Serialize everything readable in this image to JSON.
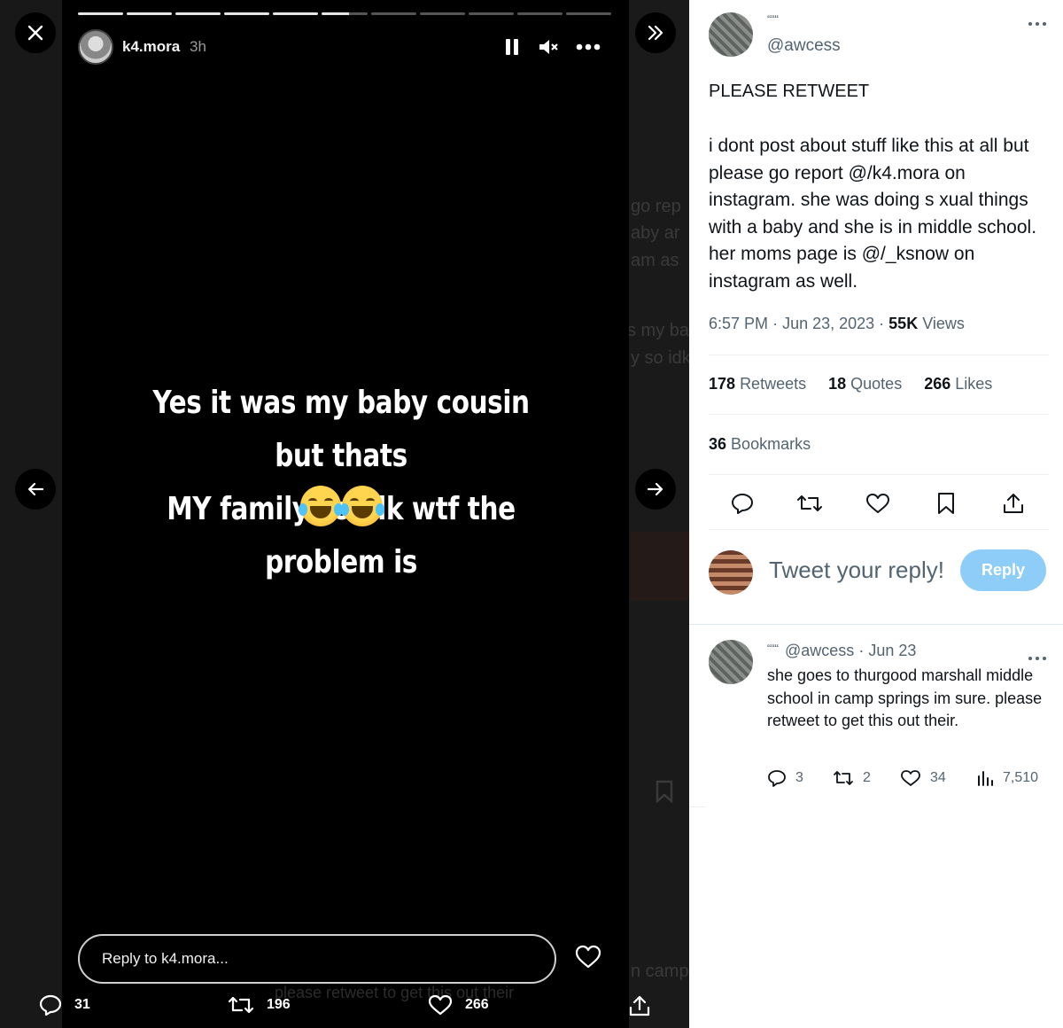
{
  "story": {
    "username": "k4.mora",
    "time": "3h",
    "text_line1": "Yes it was my baby cousin but thats",
    "text_line2": "MY family so idk wtf the problem is",
    "emojis": [
      "face-with-tears-of-joy",
      "face-with-tears-of-joy"
    ],
    "reply_placeholder": "Reply to k4.mora...",
    "progress_segments": 11,
    "progress_completed": 5.6
  },
  "background_peek": {
    "lines": [
      "go rep",
      "aby ar",
      "am as",
      "s my bab",
      "y so idk",
      "n camp",
      "please retweet to get this out their"
    ]
  },
  "viewer_bar": {
    "replies": "31",
    "retweets": "196",
    "likes": "266"
  },
  "tweet": {
    "display_name_glyph": "“““",
    "handle": "@awcess",
    "heading": "PLEASE RETWEET",
    "body": "i dont post about stuff like this at all but please go report @/k4.mora on instagram. she was doing s  xual things with a baby and she is in middle school. her moms page is @/_ksnow on instagram as well.",
    "time": "6:57 PM",
    "date": "Jun 23, 2023",
    "views_count": "55K",
    "views_label": "Views",
    "retweets_count": "178",
    "retweets_label": "Retweets",
    "quotes_count": "18",
    "quotes_label": "Quotes",
    "likes_count": "266",
    "likes_label": "Likes",
    "bookmarks_count": "36",
    "bookmarks_label": "Bookmarks"
  },
  "compose": {
    "placeholder": "Tweet your reply!",
    "button_label": "Reply"
  },
  "reply": {
    "display_name_glyph": "“““",
    "handle": "@awcess",
    "date": "Jun 23",
    "body": "she goes to thurgood marshall middle school in camp springs im sure. please retweet to get this out their.",
    "replies": "3",
    "retweets": "2",
    "likes": "34",
    "views": "7,510"
  },
  "colors": {
    "reply_button": "#8ecdf8",
    "secondary_text": "#536471",
    "primary_text": "#0f1419"
  }
}
